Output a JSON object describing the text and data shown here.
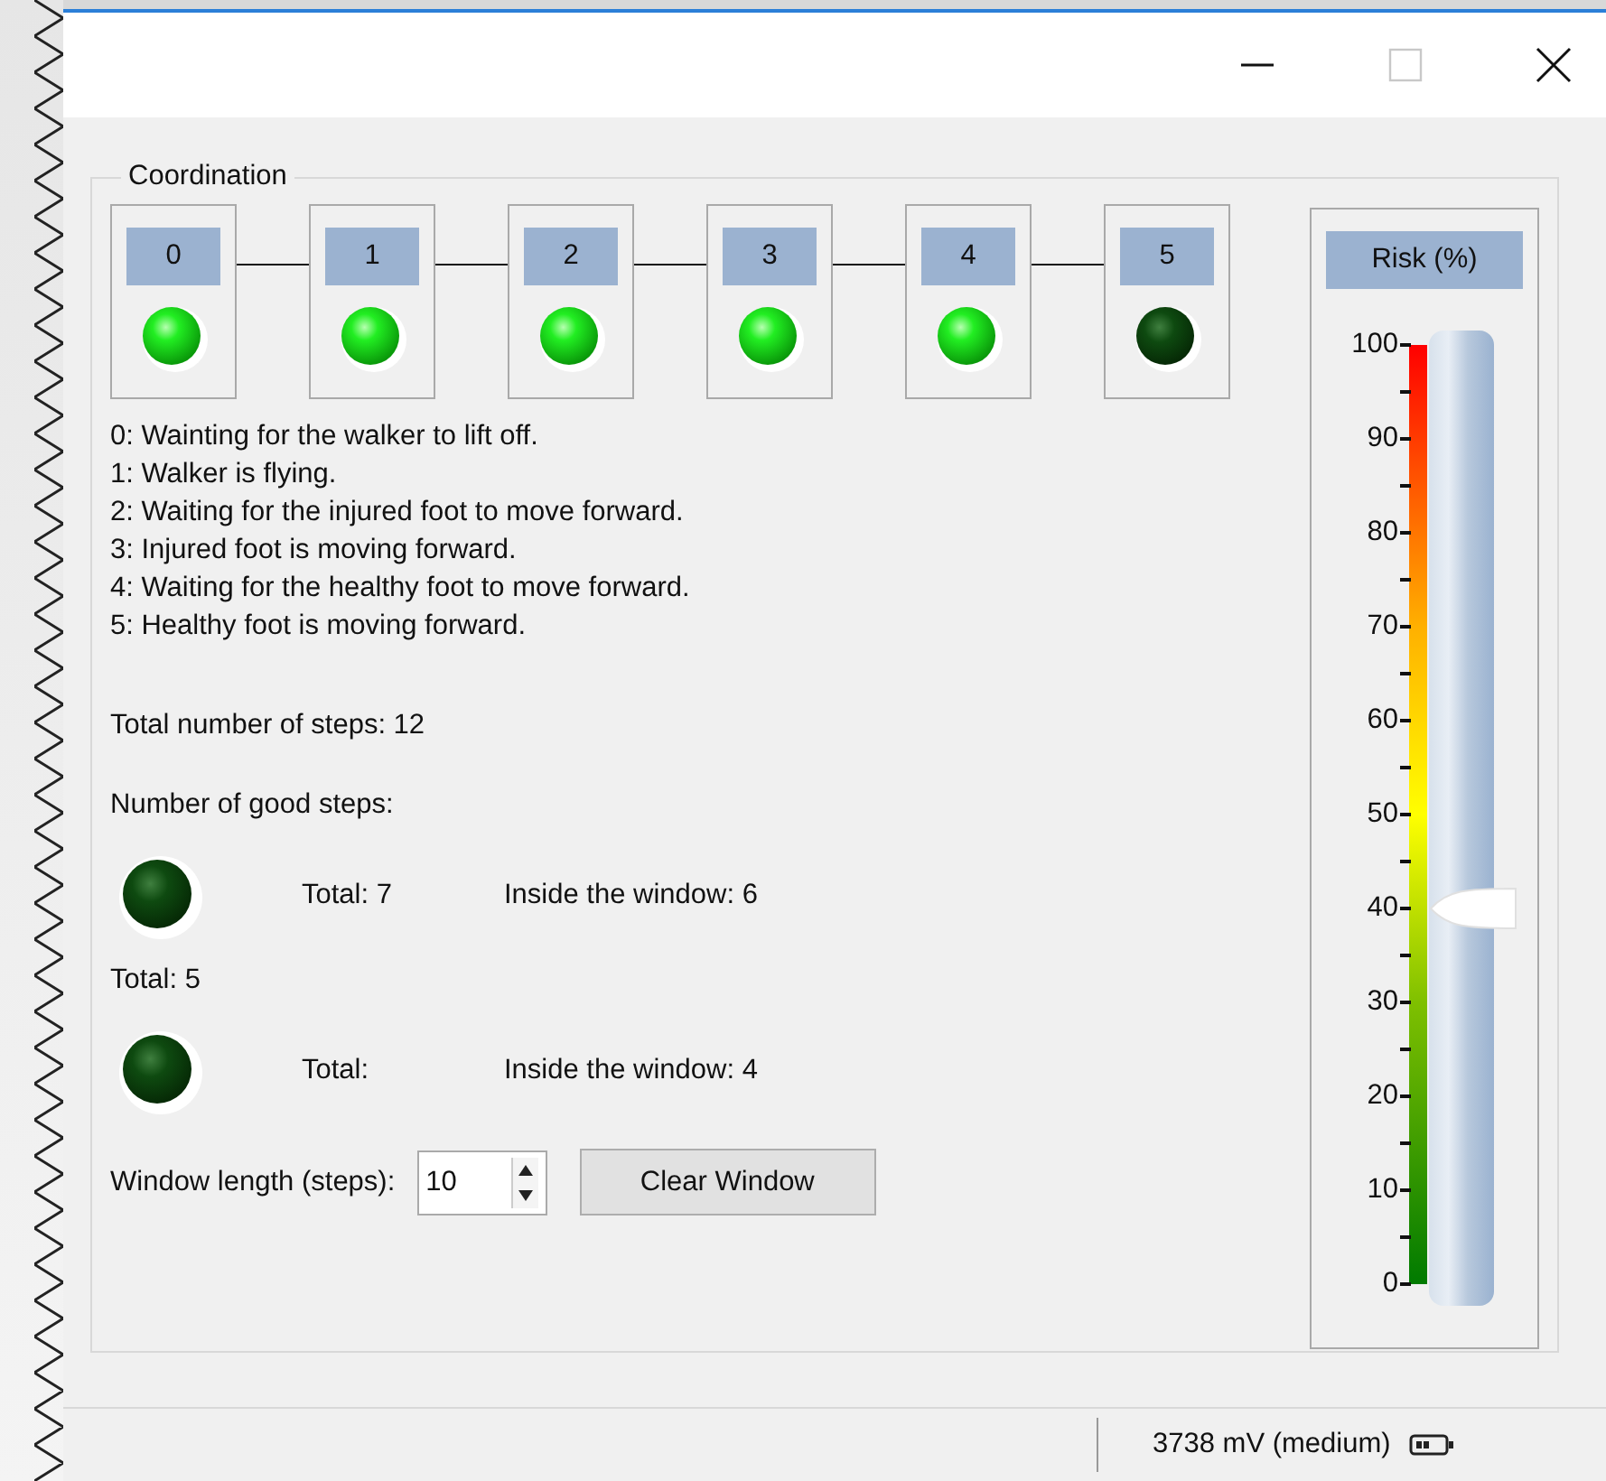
{
  "group_title": "Coordination",
  "states": [
    {
      "label": "0",
      "lit": true
    },
    {
      "label": "1",
      "lit": true
    },
    {
      "label": "2",
      "lit": true
    },
    {
      "label": "3",
      "lit": true
    },
    {
      "label": "4",
      "lit": true
    },
    {
      "label": "5",
      "lit": false
    }
  ],
  "descriptions": [
    "0: Wainting for the walker to lift off.",
    "1: Walker is flying.",
    "2: Waiting for the injured foot to move forward.",
    "3: Injured foot is moving forward.",
    "4: Waiting for the healthy foot to move forward.",
    "5: Healthy foot is moving forward."
  ],
  "total_steps": "Total number of steps: 12",
  "good_steps_label": "Number of good steps:",
  "step_rows": [
    {
      "lit": false,
      "total": "Total: 7",
      "inside": "Inside the window: 6",
      "after": "Total: 5"
    },
    {
      "lit": false,
      "total": "Total:",
      "inside": "Inside the window: 4"
    }
  ],
  "window_length": {
    "label": "Window length (steps):",
    "value": "10"
  },
  "clear_button": "Clear Window",
  "risk": {
    "title": "Risk (%)",
    "scale": [
      "100",
      "90",
      "80",
      "70",
      "60",
      "50",
      "40",
      "30",
      "20",
      "10",
      "0"
    ],
    "level": 0.4
  },
  "status": "3738 mV (medium)"
}
